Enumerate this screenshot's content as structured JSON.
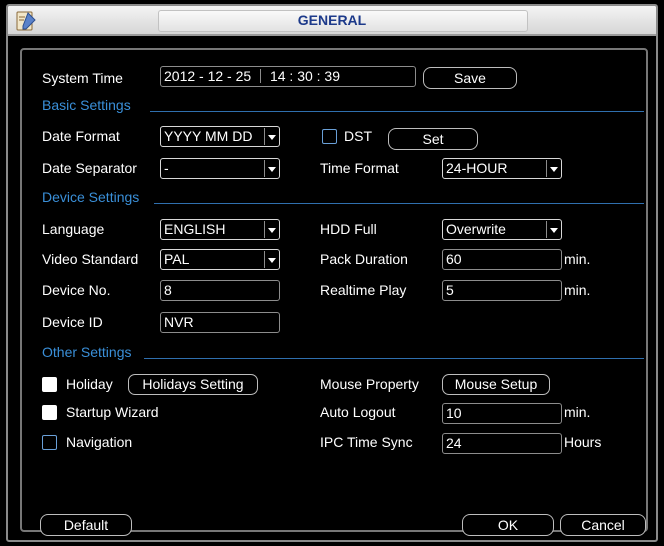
{
  "window": {
    "title": "GENERAL"
  },
  "system_time": {
    "label": "System Time",
    "date": "2012 - 12 - 25",
    "time": "14 : 30 : 39",
    "save_label": "Save"
  },
  "basic": {
    "heading": "Basic Settings",
    "date_format": {
      "label": "Date Format",
      "value": "YYYY MM DD"
    },
    "dst": {
      "label": "DST",
      "checked": false,
      "set_label": "Set"
    },
    "date_separator": {
      "label": "Date Separator",
      "value": "-"
    },
    "time_format": {
      "label": "Time Format",
      "value": "24-HOUR"
    }
  },
  "device": {
    "heading": "Device Settings",
    "language": {
      "label": "Language",
      "value": "ENGLISH"
    },
    "hdd_full": {
      "label": "HDD Full",
      "value": "Overwrite"
    },
    "video_standard": {
      "label": "Video Standard",
      "value": "PAL"
    },
    "pack_duration": {
      "label": "Pack Duration",
      "value": "60",
      "unit": "min."
    },
    "device_no": {
      "label": "Device No.",
      "value": "8"
    },
    "realtime_play": {
      "label": "Realtime Play",
      "value": "5",
      "unit": "min."
    },
    "device_id": {
      "label": "Device ID",
      "value": "NVR"
    }
  },
  "other": {
    "heading": "Other Settings",
    "holiday": {
      "label": "Holiday",
      "checked": true,
      "button_label": "Holidays Setting"
    },
    "mouse_property": {
      "label": "Mouse Property",
      "button_label": "Mouse Setup"
    },
    "startup_wizard": {
      "label": "Startup Wizard",
      "checked": true
    },
    "auto_logout": {
      "label": "Auto Logout",
      "value": "10",
      "unit": "min."
    },
    "navigation": {
      "label": "Navigation",
      "checked": false
    },
    "ipc_time_sync": {
      "label": "IPC Time Sync",
      "value": "24",
      "unit": "Hours"
    }
  },
  "footer": {
    "default_label": "Default",
    "ok_label": "OK",
    "cancel_label": "Cancel"
  },
  "colors": {
    "section": "#3a8fd8",
    "title": "#1d3a8a",
    "background": "#000000"
  },
  "icons": {
    "app": "edit-document-icon",
    "dropdown": "chevron-down-icon"
  }
}
